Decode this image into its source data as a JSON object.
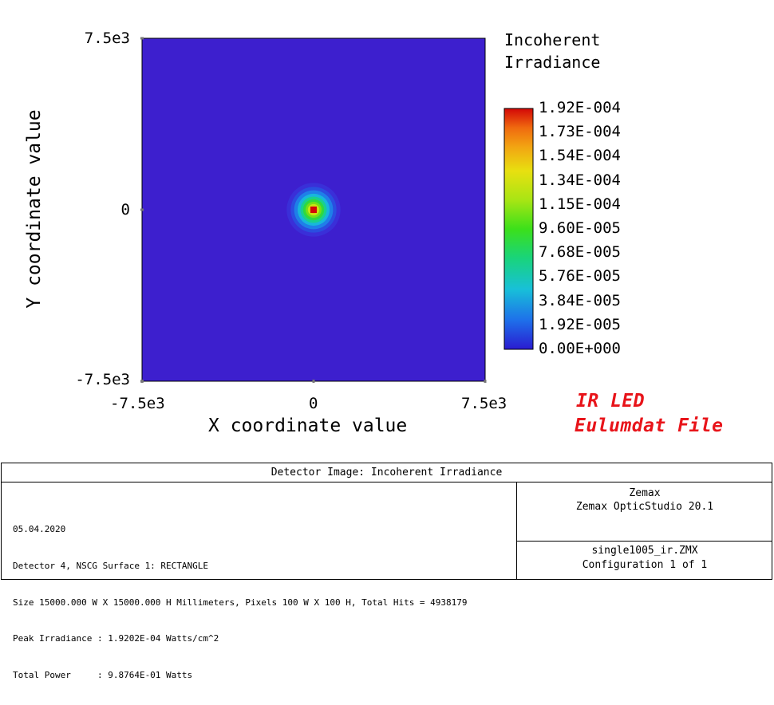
{
  "chart_data": {
    "type": "heatmap",
    "title": "Incoherent Irradiance",
    "title_lines": [
      "Incoherent",
      "Irradiance"
    ],
    "xlabel": "X coordinate value",
    "ylabel": "Y coordinate value",
    "xlim": [
      -7500,
      7500
    ],
    "ylim": [
      -7500,
      7500
    ],
    "x_ticks": [
      "-7.5e3",
      "0",
      "7.5e3"
    ],
    "y_ticks": [
      "7.5e3",
      "0",
      "-7.5e3"
    ],
    "grid": false,
    "background_value": 0.0,
    "peak": {
      "x": 0,
      "y": 0,
      "value": 0.00019202
    },
    "spot_radius": 500,
    "colorbar": {
      "min": 0.0,
      "max": 0.000192,
      "labels": [
        "1.92E-004",
        "1.73E-004",
        "1.54E-004",
        "1.34E-004",
        "1.15E-004",
        "9.60E-005",
        "7.68E-005",
        "5.76E-005",
        "3.84E-005",
        "1.92E-005",
        "0.00E+000"
      ],
      "colors": [
        "#2a1bd0",
        "#1e6fea",
        "#18c0d8",
        "#19d47a",
        "#3ce01a",
        "#a8e514",
        "#e8e010",
        "#f2a512",
        "#f06a0f",
        "#d30707"
      ]
    },
    "colors": {
      "background": "#3d1fce",
      "peak": "#d30707"
    }
  },
  "annotation": {
    "line1": "IR LED",
    "line2": "Eulumdat File"
  },
  "footer": {
    "title": "Detector Image: Incoherent Irradiance",
    "date": "05.04.2020",
    "detector": "Detector 4, NSCG Surface 1: RECTANGLE",
    "size": "Size 15000.000 W X 15000.000 H Millimeters, Pixels 100 W X 100 H, Total Hits = 4938179",
    "peak": "Peak Irradiance : 1.9202E-04 Watts/cm^2",
    "power": "Total Power     : 9.8764E-01 Watts",
    "company": "Zemax",
    "product": "Zemax OpticStudio 20.1",
    "file": "single1005_ir.ZMX",
    "config": "Configuration 1 of 1"
  }
}
